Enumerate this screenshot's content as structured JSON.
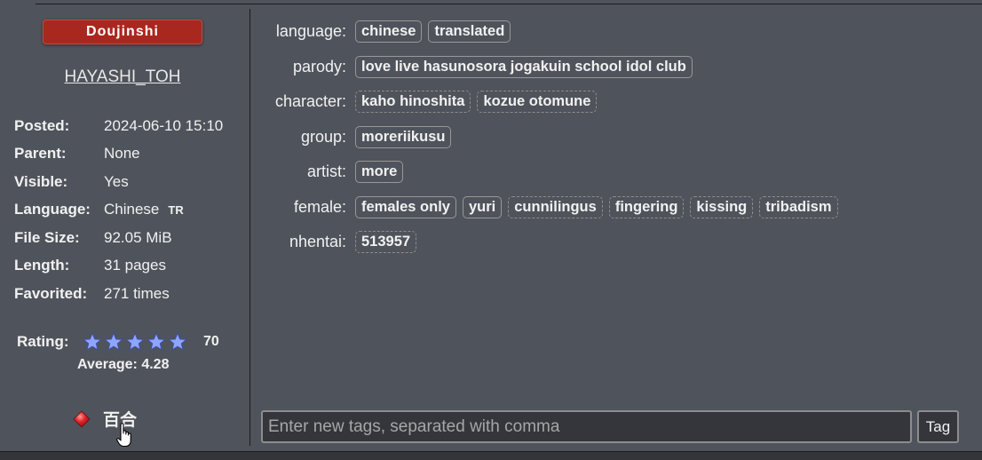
{
  "category": "Doujinshi",
  "uploader": "HAYASHI_TOH",
  "info": [
    {
      "key": "Posted:",
      "value": "2024-06-10 15:10"
    },
    {
      "key": "Parent:",
      "value": "None"
    },
    {
      "key": "Visible:",
      "value": "Yes"
    },
    {
      "key": "Language:",
      "value": "Chinese",
      "badge": "TR"
    },
    {
      "key": "File Size:",
      "value": "92.05 MiB"
    },
    {
      "key": "Length:",
      "value": "31 pages"
    },
    {
      "key": "Favorited:",
      "value": "271 times"
    }
  ],
  "rating": {
    "label": "Rating:",
    "stars": 5,
    "count": "70",
    "average": "Average: 4.28",
    "star_color": "#8ea4ff"
  },
  "favorite": {
    "label": "百合",
    "icon": "red-diamond-icon",
    "color": "#e0242a"
  },
  "tags": [
    {
      "namespace": "language:",
      "items": [
        {
          "text": "chinese",
          "dashed": false
        },
        {
          "text": "translated",
          "dashed": false
        }
      ]
    },
    {
      "namespace": "parody:",
      "items": [
        {
          "text": "love live hasunosora jogakuin school idol club",
          "dashed": false
        }
      ]
    },
    {
      "namespace": "character:",
      "items": [
        {
          "text": "kaho hinoshita",
          "dashed": true
        },
        {
          "text": "kozue otomune",
          "dashed": true
        }
      ]
    },
    {
      "namespace": "group:",
      "items": [
        {
          "text": "moreriikusu",
          "dashed": false
        }
      ]
    },
    {
      "namespace": "artist:",
      "items": [
        {
          "text": "more",
          "dashed": false
        }
      ]
    },
    {
      "namespace": "female:",
      "items": [
        {
          "text": "females only",
          "dashed": false
        },
        {
          "text": "yuri",
          "dashed": false
        },
        {
          "text": "cunnilingus",
          "dashed": true
        },
        {
          "text": "fingering",
          "dashed": true
        },
        {
          "text": "kissing",
          "dashed": true
        },
        {
          "text": "tribadism",
          "dashed": true
        }
      ]
    },
    {
      "namespace": "nhentai:",
      "items": [
        {
          "text": "513957",
          "dashed": true
        }
      ]
    }
  ],
  "tag_input": {
    "placeholder": "Enter new tags, separated with comma",
    "value": ""
  },
  "tag_button": "Tag",
  "colors": {
    "background": "#4f535b",
    "category": "#a8281f",
    "input_bg": "#35363b"
  }
}
